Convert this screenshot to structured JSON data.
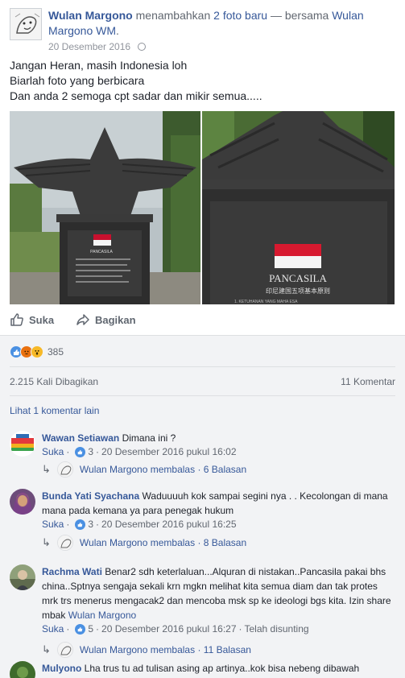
{
  "header": {
    "author": "Wulan Margono",
    "action_text": "menambahkan",
    "photo_link": "2 foto baru",
    "with_text": "— bersama",
    "tagged": "Wulan Margono WM",
    "tagged_suffix": ".",
    "date": "20 Desember 2016",
    "privacy_icon": "globe-icon"
  },
  "caption": {
    "lines": [
      "Jangan Heran, masih Indonesia loh",
      "Biarlah foto yang berbicara",
      "Dan anda 2 semoga cpt sadar dan mikir semua....."
    ]
  },
  "photos": {
    "photo_1_plaque_title": "PANCASILA",
    "photo_2_plaque_title": "PANCASILA",
    "photo_2_chinese": "印尼建国五项基本原则",
    "photo_2_subline": "1. KETUHANAN YANG MAHA ESA"
  },
  "actions": {
    "like_label": "Suka",
    "share_label": "Bagikan"
  },
  "feedback": {
    "reaction_count": "385",
    "shares": "2.215 Kali Dibagikan",
    "comments_count": "11 Komentar",
    "view_previous": "Lihat 1 komentar lain"
  },
  "comments": [
    {
      "name": "Wawan Setiawan",
      "text": "Dimana ini ?",
      "like_label": "Suka",
      "likes": "3",
      "timestamp": "20 Desember 2016 pukul 16:02",
      "reply_author": "Wulan Margono",
      "reply_text": "membalas",
      "reply_count": "6 Balasan"
    },
    {
      "name": "Bunda Yati Syachana",
      "text": "Waduuuuh kok sampai segini nya . . Kecolongan di mana mana pada kemana ya para penegak hukum",
      "like_label": "Suka",
      "likes": "3",
      "timestamp": "20 Desember 2016 pukul 16:25",
      "reply_author": "Wulan Margono",
      "reply_text": "membalas",
      "reply_count": "8 Balasan"
    },
    {
      "name": "Rachma Wati",
      "text": "Benar2 sdh keterlaluan...Alquran di nistakan..Pancasila pakai bhs china..Sptnya sengaja sekali krn mgkn melihat kita semua diam dan tak protes mrk trs menerus mengacak2 dan mencoba msk sp ke ideologi bgs kita. Izin share mbak",
      "mention": "Wulan Margono",
      "like_label": "Suka",
      "likes": "5",
      "timestamp": "20 Desember 2016 pukul 16:27",
      "edited": "Telah disunting",
      "reply_author": "Wulan Margono",
      "reply_text": "membalas",
      "reply_count": "11 Balasan"
    },
    {
      "name": "Mulyono",
      "text": "Lha trus tu ad tulisan asing ap artinya..kok bisa nebeng dibawah"
    }
  ],
  "colors": {
    "link": "#365899",
    "muted": "#616770",
    "feedback_bg": "#f2f3f5",
    "like_blue": "#4a90e2"
  }
}
